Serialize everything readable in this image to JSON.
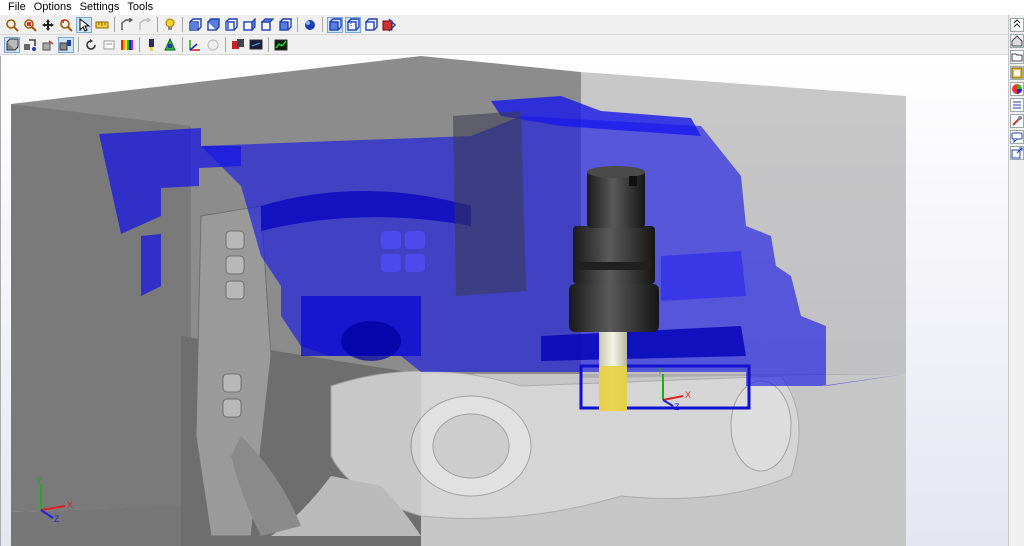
{
  "menu": {
    "items": [
      "File",
      "Options",
      "Settings",
      "Tools"
    ]
  },
  "toolbar_primary": {
    "icons": [
      "zoom-icon",
      "zoom-window-icon",
      "pan-icon",
      "rotate-icon",
      "select-arrow-icon",
      "measure-icon",
      "view-fit-icon",
      "view-previous-icon",
      "light-bulb-icon",
      "view-front-icon",
      "view-back-icon",
      "view-left-icon",
      "view-right-icon",
      "view-top-icon",
      "view-iso-icon",
      "shaded-icon",
      "wireframe-icon",
      "hidden-line-icon",
      "section-icon"
    ]
  },
  "toolbar_secondary": {
    "icons": [
      "stock-icon",
      "fixture-icon",
      "part-icon",
      "tool-icon",
      "reset-icon",
      "history-icon",
      "color-map-icon",
      "tool-path-icon",
      "machine-icon",
      "axis-icon",
      "check-icon",
      "stop-icon",
      "monitor-icon",
      "graph-icon"
    ]
  },
  "sidebar": {
    "icons": [
      "collapse-icon",
      "home-icon",
      "folder-icon",
      "settings-panel-icon",
      "color-wheel-icon",
      "list-icon",
      "tool-library-icon",
      "chat-icon",
      "export-icon"
    ]
  },
  "viewport": {
    "triad_main": {
      "y": "Y",
      "x": "X",
      "z": "Z"
    },
    "triad_corner": {
      "y": "Y",
      "x": "X",
      "z": "Z"
    },
    "colors": {
      "background_top": "#ffffff",
      "background_bottom": "#e6e6f2",
      "stock_gray": "#8a8a8a",
      "fixture_blue": "#1414e6",
      "tool_dark": "#2c2c2c",
      "tool_yellow": "#e8d040"
    }
  }
}
